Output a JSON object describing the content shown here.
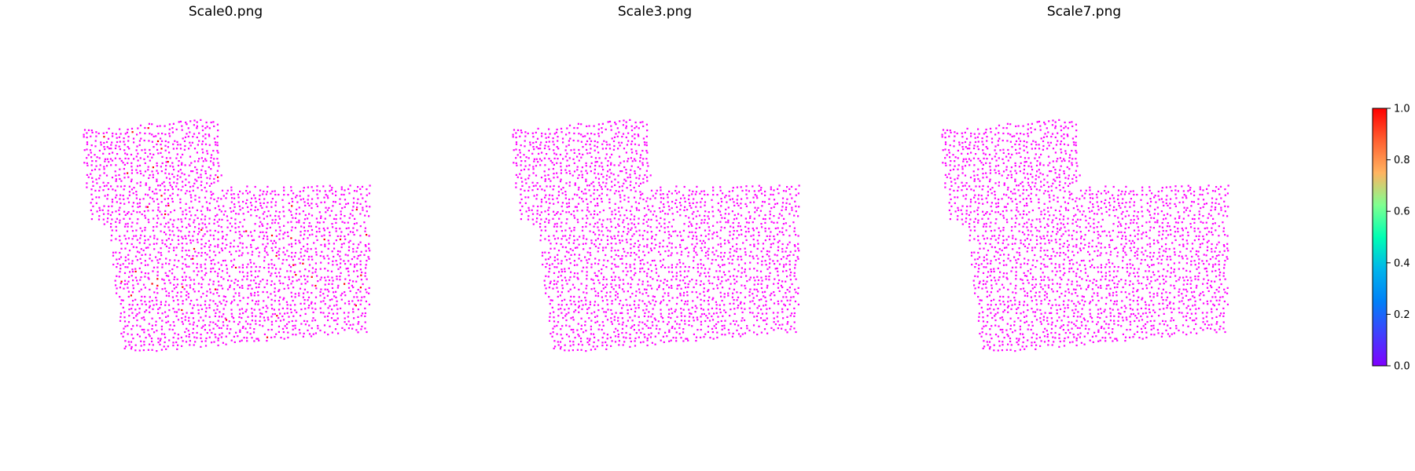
{
  "chart_data": [
    {
      "type": "scatter",
      "title": "Scale0.png",
      "xlabel": "",
      "ylabel": "",
      "axes_visible": false,
      "colormap": "rainbow",
      "value_range": [
        0,
        1
      ],
      "background_value": 0.0,
      "highlight_value": 1.0,
      "highlight_fraction": 0.02
    },
    {
      "type": "scatter",
      "title": "Scale3.png",
      "xlabel": "",
      "ylabel": "",
      "axes_visible": false,
      "colormap": "rainbow",
      "value_range": [
        0,
        1
      ],
      "background_value": 0.0,
      "highlight_value": 1.0,
      "highlight_fraction": 0.0
    },
    {
      "type": "scatter",
      "title": "Scale7.png",
      "xlabel": "",
      "ylabel": "",
      "axes_visible": false,
      "colormap": "rainbow",
      "value_range": [
        0,
        1
      ],
      "background_value": 0.0,
      "highlight_value": 1.0,
      "highlight_fraction": 0.0
    }
  ],
  "colorbar": {
    "colormap": "rainbow",
    "min": 0.0,
    "max": 1.0,
    "ticks": [
      0.0,
      0.2,
      0.4,
      0.6,
      0.8,
      1.0
    ],
    "tick_labels": [
      "0.0",
      "0.2",
      "0.4",
      "0.6",
      "0.8",
      "1.0"
    ],
    "low_color": "#7f00ff",
    "high_color": "#ff0000"
  }
}
